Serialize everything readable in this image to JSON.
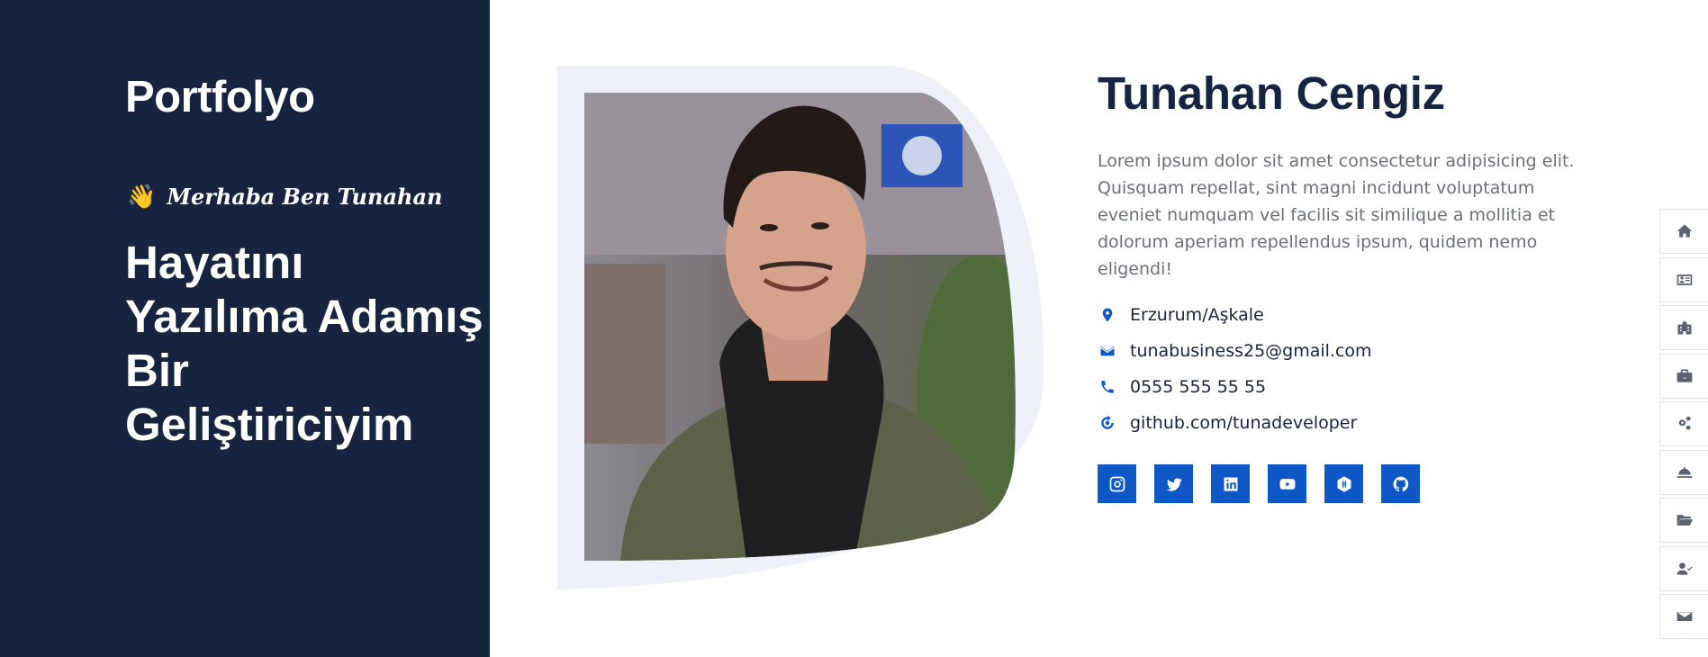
{
  "brand": "Portfolyo",
  "greeting": {
    "emoji": "👋",
    "text": "Merhaba Ben Tunahan"
  },
  "headline": "Hayatını Yazılıma Adamış Bir Geliştiriciyim",
  "profile": {
    "name": "Tunahan Cengiz",
    "bio": "Lorem ipsum dolor sit amet consectetur adipisicing elit. Quisquam repellat, sint magni incidunt voluptatum eveniet numquam vel facilis sit similique a mollitia et dolorum aperiam repellendus ipsum, quidem nemo eligendi!",
    "contacts": [
      {
        "icon": "map-marker-icon",
        "text": "Erzurum/Aşkale"
      },
      {
        "icon": "envelope-icon",
        "text": "tunabusiness25@gmail.com"
      },
      {
        "icon": "phone-icon",
        "text": "0555 555 55 55"
      },
      {
        "icon": "github-link-icon",
        "text": "github.com/tunadeveloper"
      }
    ]
  },
  "socials": [
    {
      "icon": "instagram-icon"
    },
    {
      "icon": "twitter-icon"
    },
    {
      "icon": "linkedin-icon"
    },
    {
      "icon": "youtube-icon"
    },
    {
      "icon": "hackerrank-icon"
    },
    {
      "icon": "github-icon"
    }
  ],
  "side_nav": [
    {
      "icon": "home-icon"
    },
    {
      "icon": "id-card-icon"
    },
    {
      "icon": "school-icon"
    },
    {
      "icon": "briefcase-icon"
    },
    {
      "icon": "cogs-icon"
    },
    {
      "icon": "service-bell-icon"
    },
    {
      "icon": "folder-open-icon"
    },
    {
      "icon": "user-check-icon"
    },
    {
      "icon": "envelope-icon"
    }
  ],
  "colors": {
    "panel": "#17243f",
    "accent": "#0d57c7",
    "frame": "#eef2f8"
  }
}
